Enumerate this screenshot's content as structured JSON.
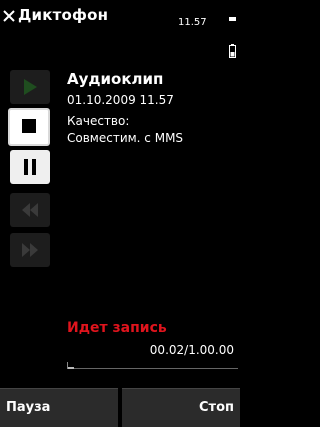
{
  "header": {
    "title": "Диктофон",
    "clock": "11.57"
  },
  "controls": [
    {
      "name": "play",
      "state": "disabled"
    },
    {
      "name": "record",
      "state": "selected"
    },
    {
      "name": "pause",
      "state": "enabled"
    },
    {
      "name": "rewind",
      "state": "disabled"
    },
    {
      "name": "fast-forward",
      "state": "disabled"
    }
  ],
  "clip": {
    "name": "Аудиоклип",
    "datetime": "01.10.2009 11.57",
    "quality_label": "Качество:",
    "quality_value": "Совместим. с MMS"
  },
  "recording": {
    "status": "Идет запись",
    "time": "00.02/1.00.00",
    "progress": 0.033
  },
  "softkeys": {
    "left": "Пауза",
    "right": "Стоп"
  },
  "colors": {
    "background": "#000000",
    "status_text": "#e0141d",
    "softkey_bg": "#2b2b2b"
  }
}
